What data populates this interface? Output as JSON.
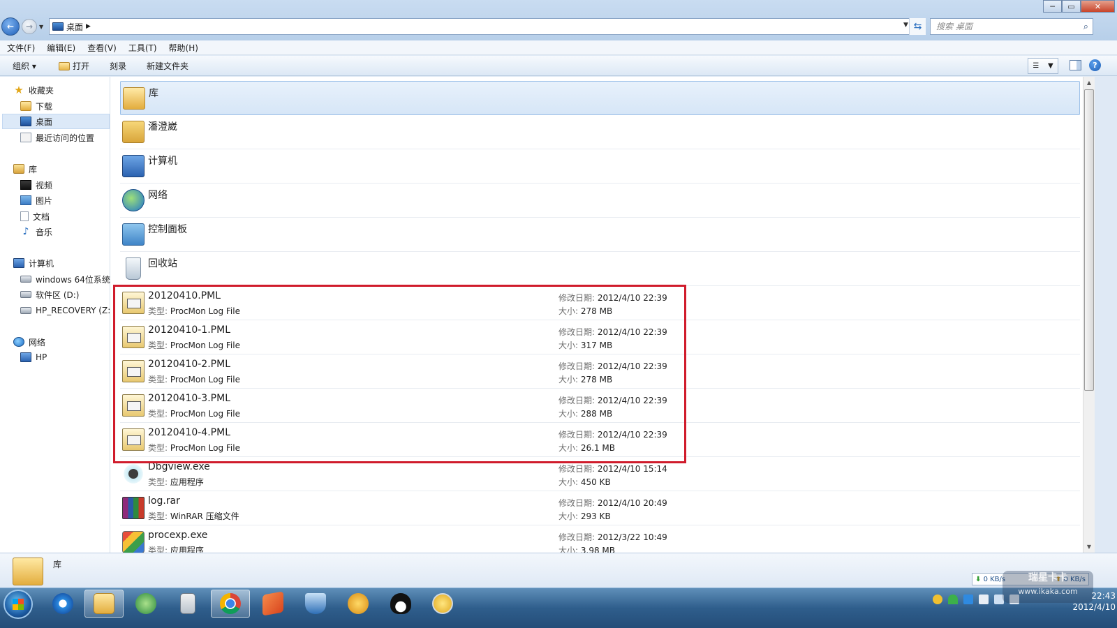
{
  "window": {
    "min": "─",
    "max": "▭",
    "close": "✕"
  },
  "nav": {
    "back": "←",
    "fwd": "→"
  },
  "address": {
    "location": "桌面"
  },
  "search": {
    "placeholder": "搜索 桌面"
  },
  "menu": [
    "文件(F)",
    "编辑(E)",
    "查看(V)",
    "工具(T)",
    "帮助(H)"
  ],
  "toolbar": {
    "organize": "组织 ▾",
    "open": "打开",
    "burn": "刻录",
    "new_folder": "新建文件夹",
    "help": "?"
  },
  "sidebar": {
    "favorites": "收藏夹",
    "downloads": "下载",
    "desktop": "桌面",
    "recent": "最近访问的位置",
    "libraries": "库",
    "videos": "视频",
    "pictures": "图片",
    "documents": "文档",
    "music": "音乐",
    "computer": "计算机",
    "drive_c": "windows 64位系统",
    "drive_d": "软件区 (D:)",
    "drive_z": "HP_RECOVERY (Z:)",
    "network": "网络",
    "net_hp": "HP"
  },
  "items": [
    {
      "name": "库"
    },
    {
      "name": "潘澄崴"
    },
    {
      "name": "计算机"
    },
    {
      "name": "网络"
    },
    {
      "name": "控制面板"
    },
    {
      "name": "回收站"
    },
    {
      "name": "20120410.PML",
      "type_label": "类型:",
      "type": "ProcMon Log File",
      "mod_label": "修改日期:",
      "mod": "2012/4/10 22:39",
      "size_label": "大小:",
      "size": "278 MB"
    },
    {
      "name": "20120410-1.PML",
      "type_label": "类型:",
      "type": "ProcMon Log File",
      "mod_label": "修改日期:",
      "mod": "2012/4/10 22:39",
      "size_label": "大小:",
      "size": "317 MB"
    },
    {
      "name": "20120410-2.PML",
      "type_label": "类型:",
      "type": "ProcMon Log File",
      "mod_label": "修改日期:",
      "mod": "2012/4/10 22:39",
      "size_label": "大小:",
      "size": "278 MB"
    },
    {
      "name": "20120410-3.PML",
      "type_label": "类型:",
      "type": "ProcMon Log File",
      "mod_label": "修改日期:",
      "mod": "2012/4/10 22:39",
      "size_label": "大小:",
      "size": "288 MB"
    },
    {
      "name": "20120410-4.PML",
      "type_label": "类型:",
      "type": "ProcMon Log File",
      "mod_label": "修改日期:",
      "mod": "2012/4/10 22:39",
      "size_label": "大小:",
      "size": "26.1 MB"
    },
    {
      "name": "Dbgview.exe",
      "type_label": "类型:",
      "type": "应用程序",
      "mod_label": "修改日期:",
      "mod": "2012/4/10 15:14",
      "size_label": "大小:",
      "size": "450 KB"
    },
    {
      "name": "log.rar",
      "type_label": "类型:",
      "type": "WinRAR 压缩文件",
      "mod_label": "修改日期:",
      "mod": "2012/4/10 20:49",
      "size_label": "大小:",
      "size": "293 KB"
    },
    {
      "name": "procexp.exe",
      "type_label": "类型:",
      "type": "应用程序",
      "mod_label": "修改日期:",
      "mod": "2012/3/22 10:49",
      "size_label": "大小:",
      "size": "3.98 MB"
    }
  ],
  "details": {
    "title": "库"
  },
  "netspeed": {
    "down": "0 KB/s",
    "up": "0 KB/s"
  },
  "watermark": {
    "brand": "瑞星卡卡",
    "url": "www.ikaka.com"
  },
  "clock": {
    "time": "22:43",
    "date": "2012/4/10"
  }
}
